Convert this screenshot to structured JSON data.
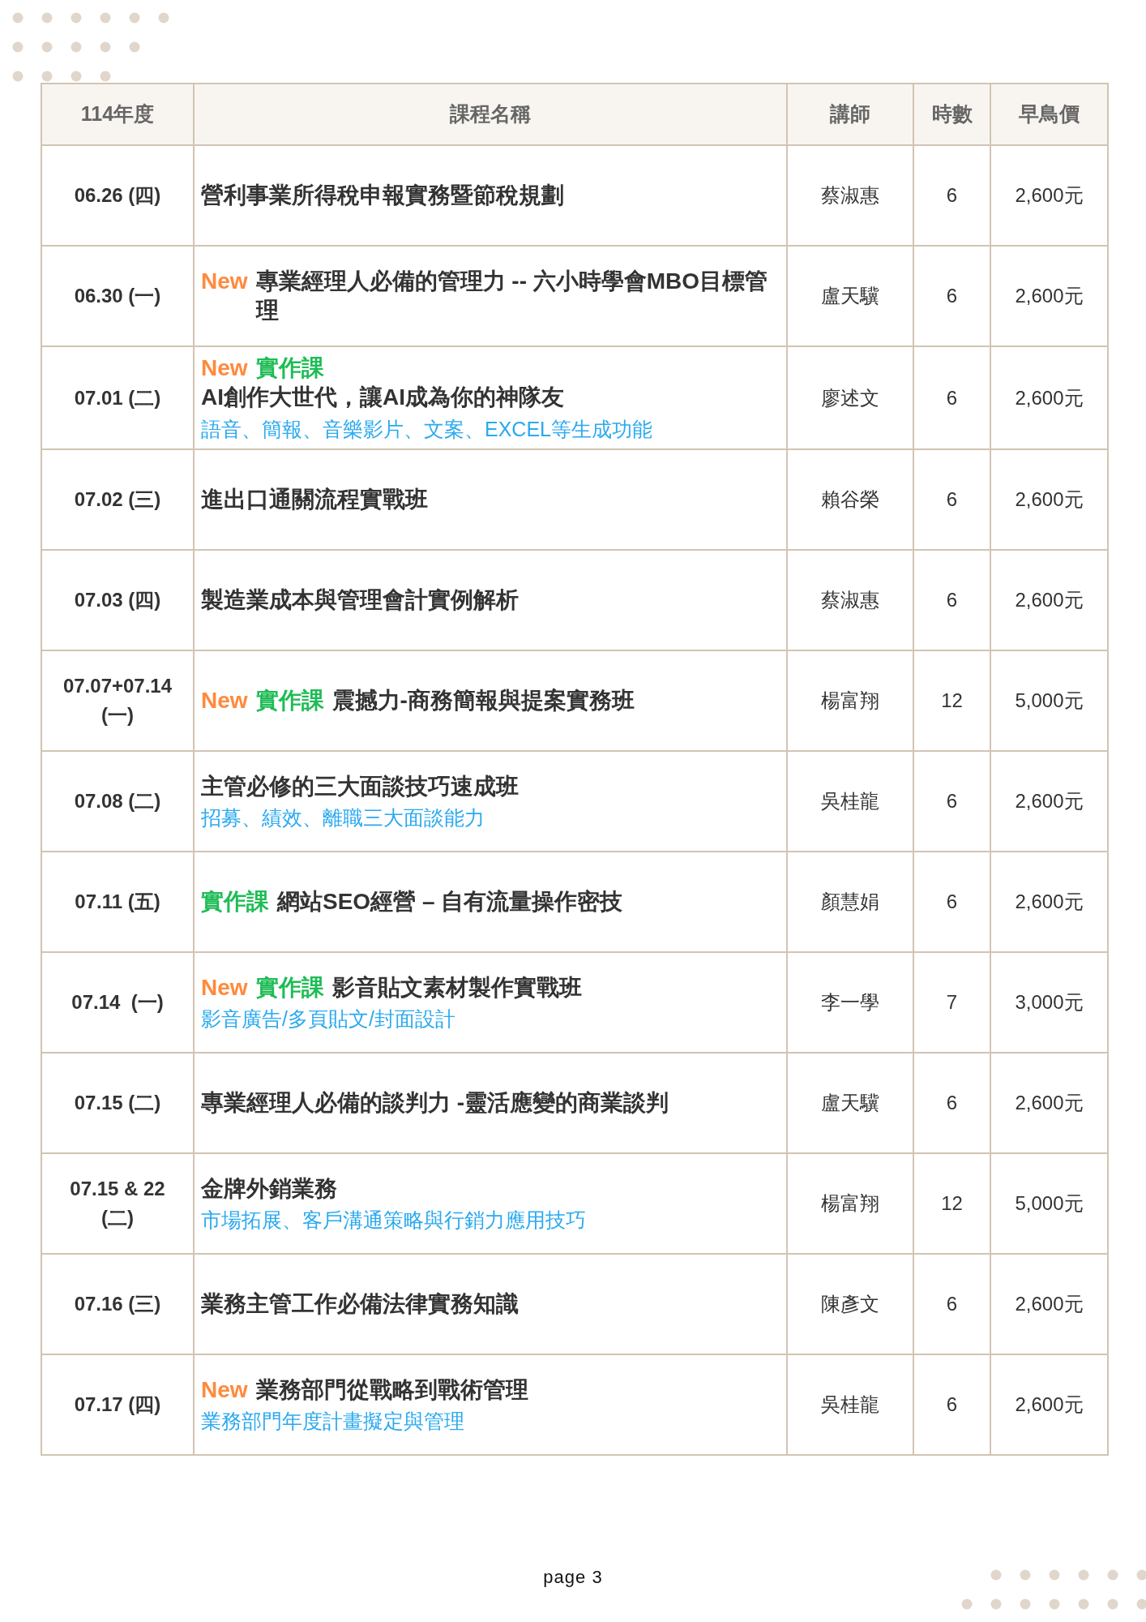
{
  "table": {
    "columns": [
      "114年度",
      "課程名稱",
      "講師",
      "時數",
      "早鳥價"
    ],
    "rows": [
      {
        "date": [
          "06.26 (四)"
        ],
        "tags": [],
        "title": "營利事業所得稅申報實務暨節稅規劃",
        "instructor": "蔡淑惠",
        "hours": "6",
        "price": "2,600元"
      },
      {
        "date": [
          "06.30 (一)"
        ],
        "tags": [
          {
            "kind": "new",
            "text": "New"
          }
        ],
        "title": "專業經理人必備的管理力 -- 六小時學會MBO目標管理",
        "instructor": "盧天驥",
        "hours": "6",
        "price": "2,600元"
      },
      {
        "date": [
          "07.01 (二)"
        ],
        "tags": [
          {
            "kind": "new",
            "text": "New"
          },
          {
            "kind": "practical",
            "text": "實作課"
          }
        ],
        "tags_own_line": true,
        "title": "AI創作大世代，讓AI成為你的神隊友",
        "subtitle": "語音、簡報、音樂影片、文案、EXCEL等生成功能",
        "instructor": "廖述文",
        "hours": "6",
        "price": "2,600元"
      },
      {
        "date": [
          "07.02 (三)"
        ],
        "tags": [],
        "title": "進出口通關流程實戰班",
        "instructor": "賴谷榮",
        "hours": "6",
        "price": "2,600元"
      },
      {
        "date": [
          "07.03 (四)"
        ],
        "tags": [],
        "title": "製造業成本與管理會計實例解析",
        "instructor": "蔡淑惠",
        "hours": "6",
        "price": "2,600元"
      },
      {
        "date": [
          "07.07+07.14",
          "(一)"
        ],
        "tags": [
          {
            "kind": "new",
            "text": "New"
          },
          {
            "kind": "practical",
            "text": "實作課"
          }
        ],
        "title": "震撼力-商務簡報與提案實務班",
        "instructor": "楊富翔",
        "hours": "12",
        "price": "5,000元"
      },
      {
        "date": [
          "07.08 (二)"
        ],
        "tags": [],
        "title": "主管必修的三大面談技巧速成班",
        "subtitle": "招募、績效、離職三大面談能力",
        "instructor": "吳桂龍",
        "hours": "6",
        "price": "2,600元"
      },
      {
        "date": [
          "07.11 (五)"
        ],
        "tags": [
          {
            "kind": "practical",
            "text": "實作課"
          }
        ],
        "title": "網站SEO經營 – 自有流量操作密技",
        "instructor": "顏慧娟",
        "hours": "6",
        "price": "2,600元"
      },
      {
        "date": [
          "07.14  (一)"
        ],
        "tags": [
          {
            "kind": "new",
            "text": "New"
          },
          {
            "kind": "practical",
            "text": "實作課"
          }
        ],
        "title": "影音貼文素材製作實戰班",
        "subtitle": "影音廣告/多頁貼文/封面設計",
        "instructor": "李一學",
        "hours": "7",
        "price": "3,000元"
      },
      {
        "date": [
          "07.15 (二)"
        ],
        "tags": [],
        "title": "專業經理人必備的談判力 -靈活應變的商業談判",
        "instructor": "盧天驥",
        "hours": "6",
        "price": "2,600元"
      },
      {
        "date": [
          "07.15 & 22",
          "(二)"
        ],
        "tags": [],
        "title": "金牌外銷業務",
        "subtitle": "市場拓展、客戶溝通策略與行銷力應用技巧",
        "instructor": "楊富翔",
        "hours": "12",
        "price": "5,000元"
      },
      {
        "date": [
          "07.16 (三)"
        ],
        "tags": [],
        "title": "業務主管工作必備法律實務知識",
        "instructor": "陳彥文",
        "hours": "6",
        "price": "2,600元"
      },
      {
        "date": [
          "07.17 (四)"
        ],
        "tags": [
          {
            "kind": "new",
            "text": "New"
          }
        ],
        "title": "業務部門從戰略到戰術管理",
        "subtitle": "業務部門年度計畫擬定與管理",
        "instructor": "吳桂龍",
        "hours": "6",
        "price": "2,600元"
      }
    ]
  },
  "footer": {
    "page_label": "page 3"
  }
}
